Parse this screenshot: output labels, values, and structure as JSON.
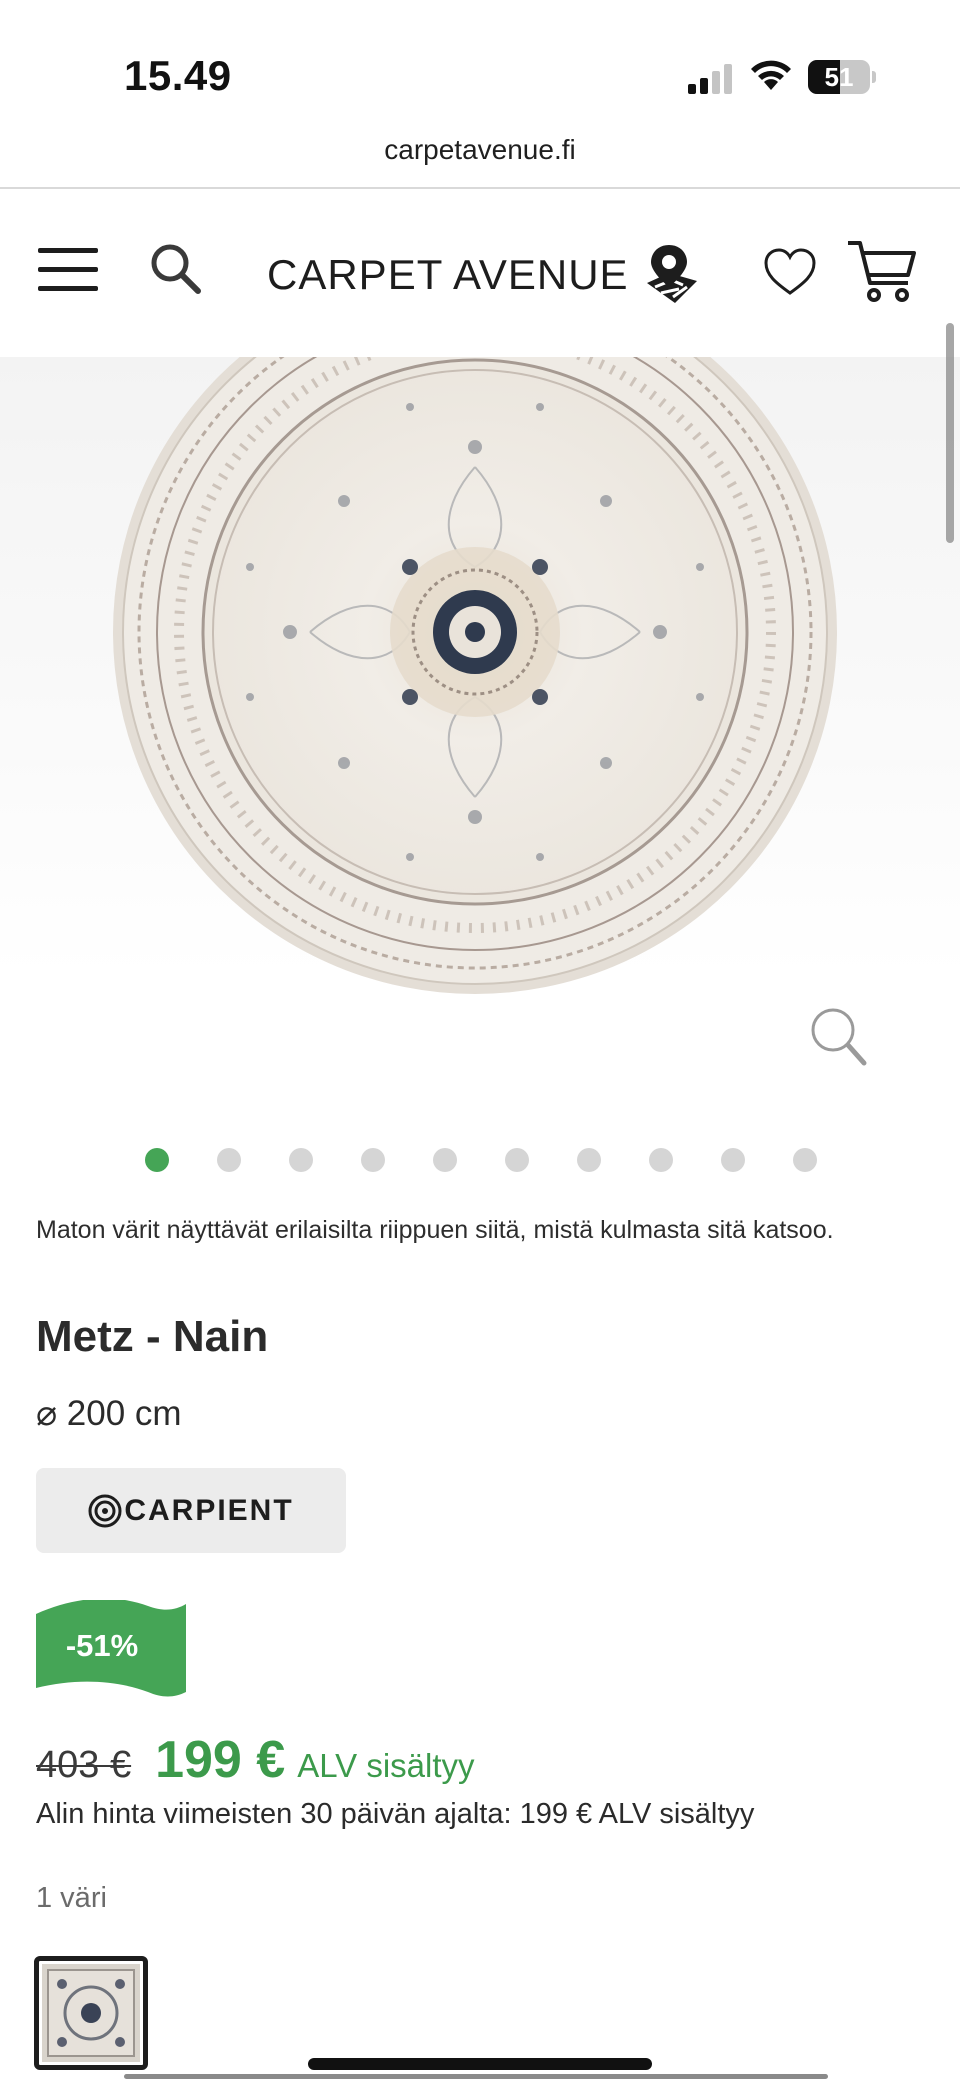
{
  "status_bar": {
    "time": "15.49",
    "battery": "51",
    "battery_level": 0.51,
    "url": "carpetavenue.fi"
  },
  "header": {
    "brand": "CARPET AVENUE",
    "icons": [
      "menu-icon",
      "search-icon",
      "map-pin-icon",
      "heart-icon",
      "cart-icon"
    ]
  },
  "gallery": {
    "image": "round-rug-image",
    "zoom_icon": "magnifier-icon",
    "total_images": 10,
    "active_index": 0
  },
  "product": {
    "color_note": "Maton värit näyttävät erilaisilta riippuen siitä, mistä kulmasta sitä katsoo.",
    "title": "Metz - Nain",
    "size": "⌀ 200 cm",
    "brand": "CARPIENT",
    "discount": "-51%",
    "old_price": "403 €",
    "price": "199 €",
    "vat": "ALV sisältyy",
    "lowest_price": "Alin hinta viimeisten 30 päivän ajalta: 199 € ALV sisältyy",
    "colors_label": "1 väri"
  },
  "colors": {
    "accent_green": "#45a556",
    "price_green": "#3c9a4b",
    "dot_inactive": "#d5d5d5"
  }
}
